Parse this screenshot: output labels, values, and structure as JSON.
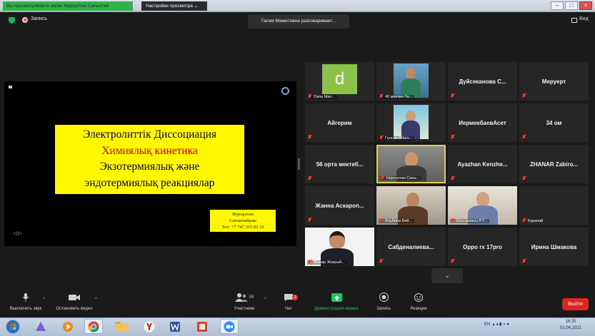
{
  "titlebar": {
    "view_banner": "Вы просматриваете экран Нурсултан Сагынтай",
    "view_options": "Настройки просмотра ⌄",
    "controls": [
      "–",
      "□",
      "×"
    ]
  },
  "meeting": {
    "recording_label": "Запись",
    "speaker_toast": "Галия Мамитовна разговаривает...",
    "view_label": "Вид"
  },
  "slide": {
    "lines": [
      "Электролиттік Диссоциация",
      "Химиялық кинетика",
      "Экзотермиялық және",
      "эндотермиялық реакциялар"
    ],
    "author_name": "Нурсұлтан",
    "author_surname": "Сағынтайұлы",
    "author_phone": "Тел: +7 747 315 82 32",
    "controls": "◁ ▷"
  },
  "participants": [
    {
      "name": "Dana Man...",
      "type": "avatar",
      "avatar_letter": "d"
    },
    {
      "name": "40 мектеп-Та...",
      "type": "video"
    },
    {
      "name": "Дүйсеканова С...",
      "type": "name"
    },
    {
      "name": "Меруерт",
      "type": "name"
    },
    {
      "name": "Айгерим",
      "type": "name"
    },
    {
      "name": "Гүлсая Абиіл...",
      "type": "video"
    },
    {
      "name": "ИермекбаевАсет",
      "type": "name"
    },
    {
      "name": "34 ом",
      "type": "name"
    },
    {
      "name": "56 орта мектеб...",
      "type": "name"
    },
    {
      "name": "Нурсултан Сағы...",
      "type": "video"
    },
    {
      "name": "Ayazhan Kenzhe...",
      "type": "name"
    },
    {
      "name": "ZHANAR Zabiro...",
      "type": "name"
    },
    {
      "name": "Жанна Аскароп...",
      "type": "name"
    },
    {
      "name": "Альбина Бей...",
      "type": "video"
    },
    {
      "name": "Есік қаласы Р.Т...",
      "type": "video"
    },
    {
      "name": "Куралай",
      "type": "video-off"
    },
    {
      "name": "Жанар Жақсыб...",
      "type": "video"
    },
    {
      "name": "Сабденалиева...",
      "type": "name"
    },
    {
      "name": "Oppo rx 17pro",
      "type": "name"
    },
    {
      "name": "Ирина Шмакова",
      "type": "name"
    }
  ],
  "gallery_more": "⌄",
  "toolbar": {
    "mute": "Выключить звук",
    "stop_video": "Остановить видео",
    "participants": "Участники",
    "participants_count": "59",
    "chat": "Чат",
    "chat_badge": "2",
    "share": "Демонстрация экрана",
    "record": "Запись",
    "reactions": "Реакции",
    "end": "Выйти"
  },
  "taskbar": {
    "language": "EN",
    "time": "16:25",
    "date": "01.04.2021"
  },
  "colors": {
    "slide_bg": "#fff800",
    "slide_red": "#e00000",
    "share_green": "#23c55e",
    "end_red": "#e0241b",
    "muted_red": "#ff3b30"
  }
}
